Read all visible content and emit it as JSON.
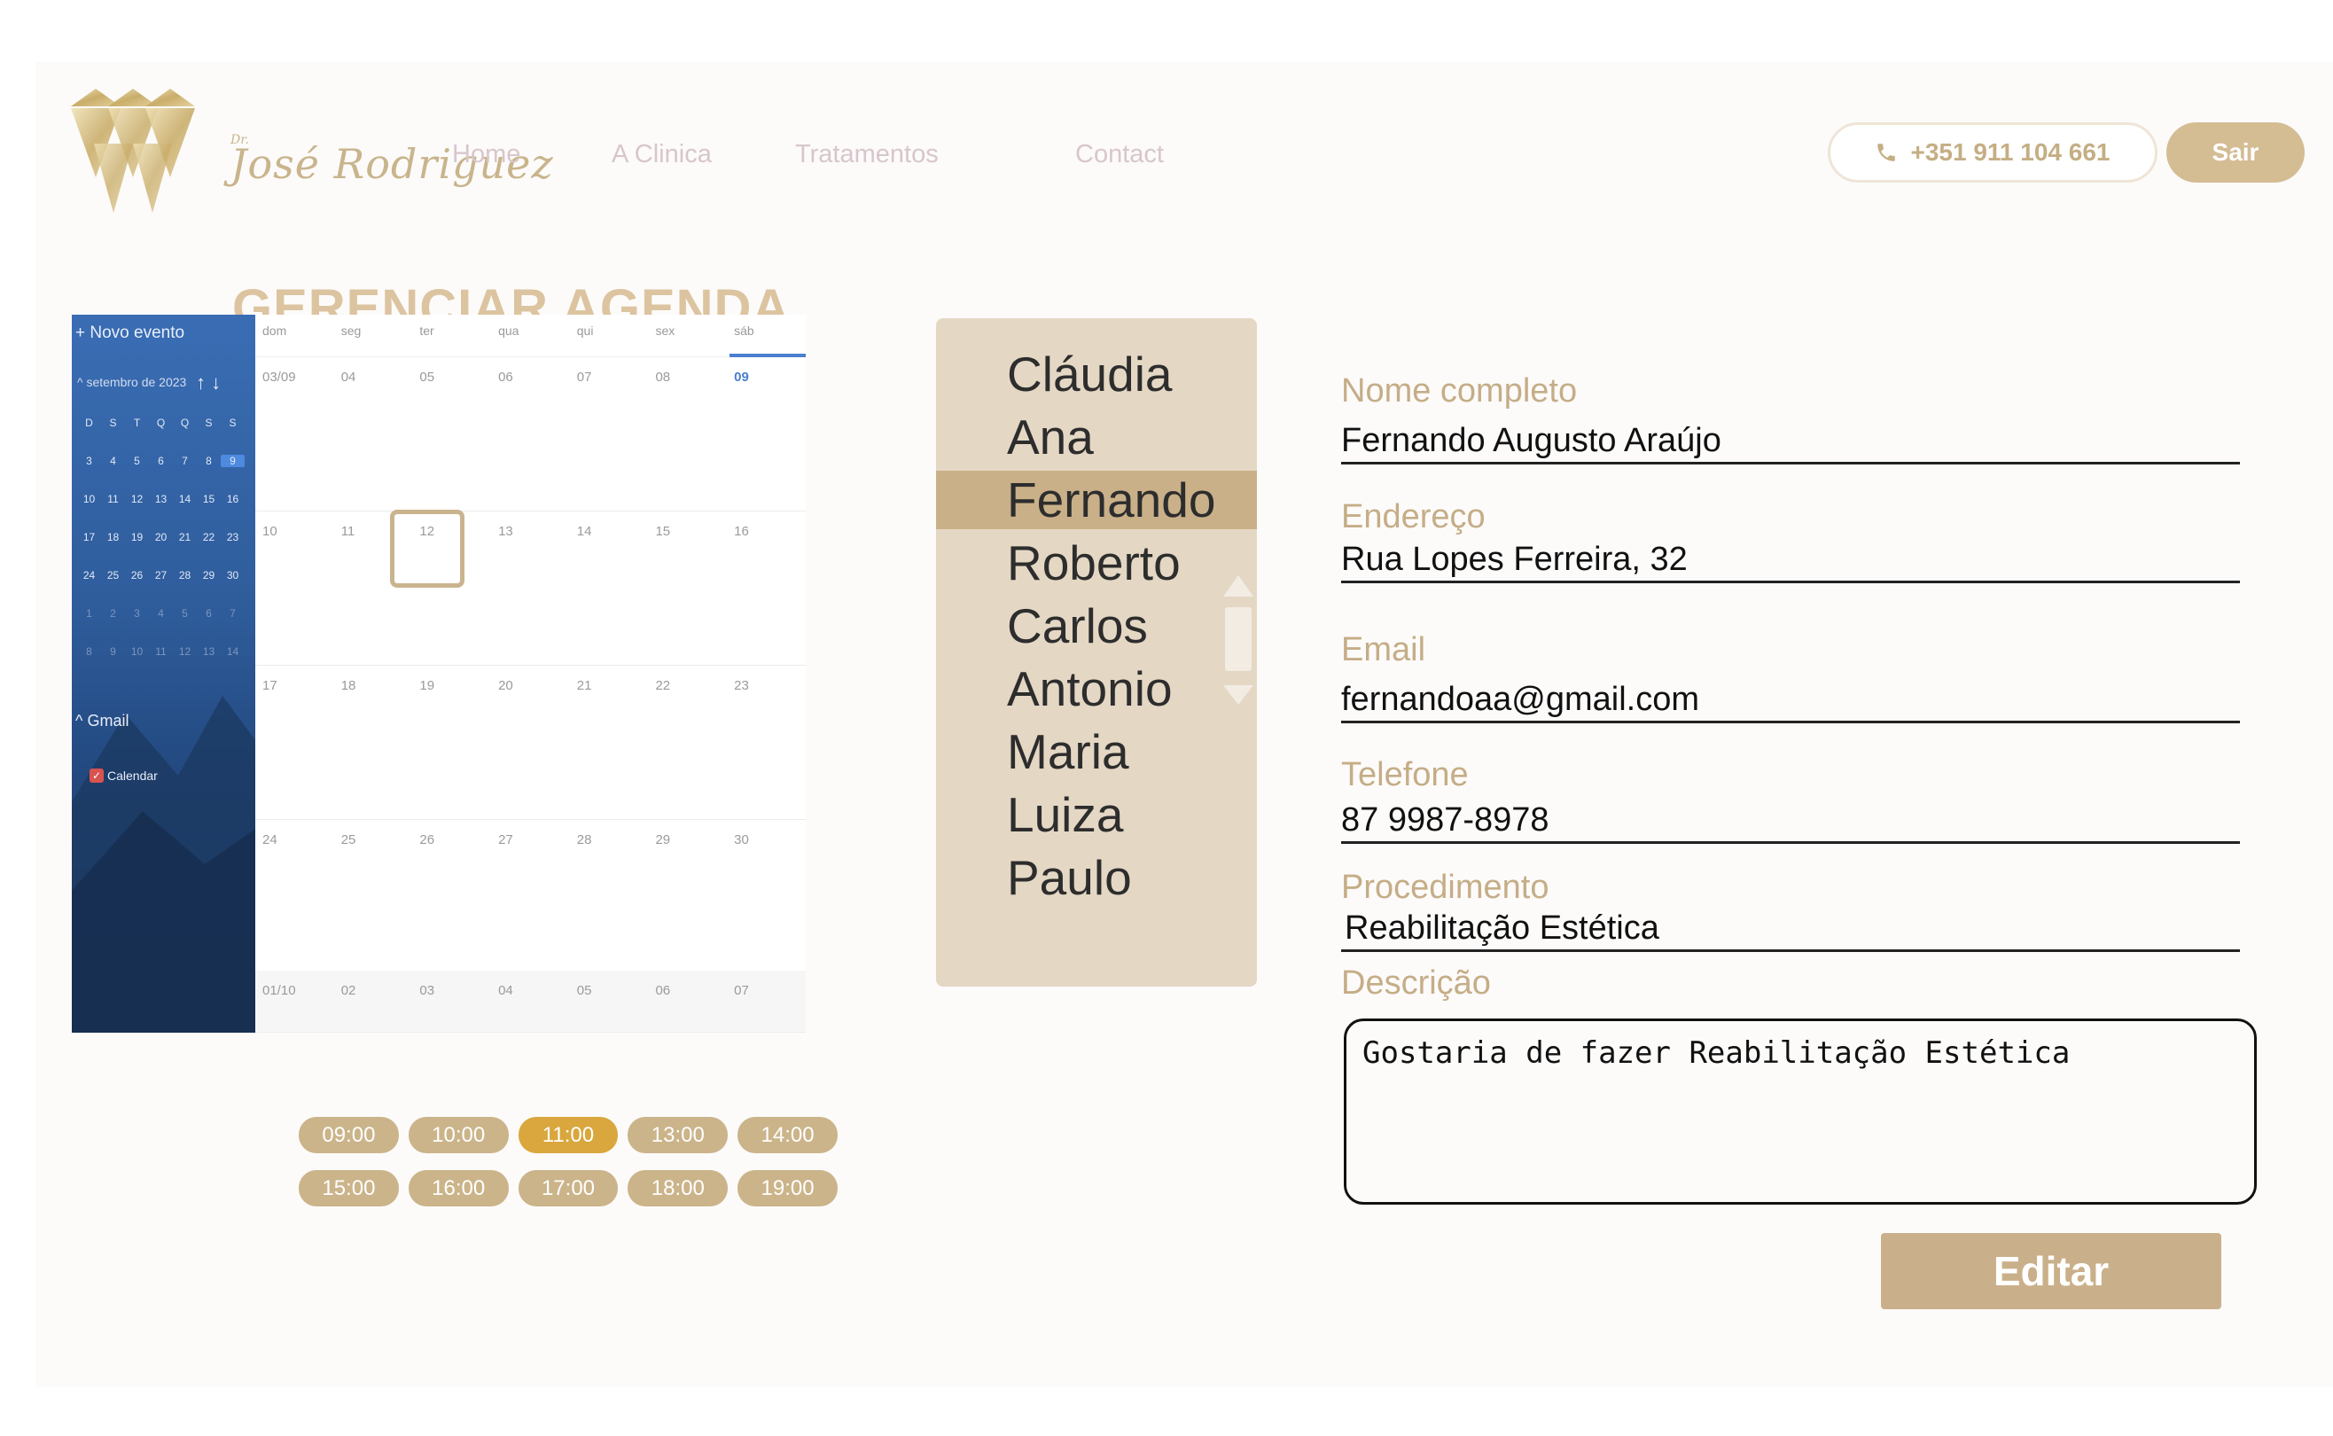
{
  "header": {
    "logo_prefix": "Dr.",
    "logo_text": "José Rodriguez",
    "nav": [
      "Home",
      "A Clinica",
      "Tratamentos",
      "Contact"
    ],
    "phone": "+351 911 104 661",
    "exit_label": "Sair"
  },
  "page_title": "GERENCIAR AGENDA",
  "calendar": {
    "new_event_label": "Novo evento",
    "month_label": "setembro de 2023",
    "mini_weekdays": [
      "D",
      "S",
      "T",
      "Q",
      "Q",
      "S",
      "S"
    ],
    "mini_weeks": [
      [
        "3",
        "4",
        "5",
        "6",
        "7",
        "8",
        "9"
      ],
      [
        "10",
        "11",
        "12",
        "13",
        "14",
        "15",
        "16"
      ],
      [
        "17",
        "18",
        "19",
        "20",
        "21",
        "22",
        "23"
      ],
      [
        "24",
        "25",
        "26",
        "27",
        "28",
        "29",
        "30"
      ],
      [
        "1",
        "2",
        "3",
        "4",
        "5",
        "6",
        "7"
      ],
      [
        "8",
        "9",
        "10",
        "11",
        "12",
        "13",
        "14"
      ]
    ],
    "gmail_label": "Gmail",
    "calendar_label": "Calendar",
    "weekdays": [
      "dom",
      "seg",
      "ter",
      "qua",
      "qui",
      "sex",
      "sáb"
    ],
    "weeks": [
      [
        "03/09",
        "04",
        "05",
        "06",
        "07",
        "08",
        "09"
      ],
      [
        "10",
        "11",
        "12",
        "13",
        "14",
        "15",
        "16"
      ],
      [
        "17",
        "18",
        "19",
        "20",
        "21",
        "22",
        "23"
      ],
      [
        "24",
        "25",
        "26",
        "27",
        "28",
        "29",
        "30"
      ],
      [
        "01/10",
        "02",
        "03",
        "04",
        "05",
        "06",
        "07"
      ]
    ],
    "today": "09",
    "selected_day": "12"
  },
  "time_slots": [
    [
      "09:00",
      "10:00",
      "11:00",
      "13:00",
      "14:00"
    ],
    [
      "15:00",
      "16:00",
      "17:00",
      "18:00",
      "19:00"
    ]
  ],
  "active_slot": "11:00",
  "patients": [
    "Cláudia",
    "Ana",
    "Fernando",
    "Roberto",
    "Carlos",
    "Antonio",
    "Maria",
    "Luiza",
    "Paulo"
  ],
  "selected_patient": "Fernando",
  "form": {
    "name_label": "Nome completo",
    "name_value": "Fernando Augusto Araújo",
    "address_label": "Endereço",
    "address_value": "Rua Lopes Ferreira, 32",
    "email_label": "Email",
    "email_value": "fernandoaa@gmail.com",
    "phone_label": "Telefone",
    "phone_value": "87 9987-8978",
    "procedure_label": "Procedimento",
    "procedure_value": "Reabilitação Estética",
    "description_label": "Descrição",
    "description_value": "Gostaria de fazer Reabilitação Estética",
    "edit_label": "Editar"
  },
  "colors": {
    "accent_gold": "#c9b08a",
    "active_slot": "#d9a73e",
    "list_bg": "#e4d7c4",
    "calendar_blue": "#2f5d9c"
  }
}
